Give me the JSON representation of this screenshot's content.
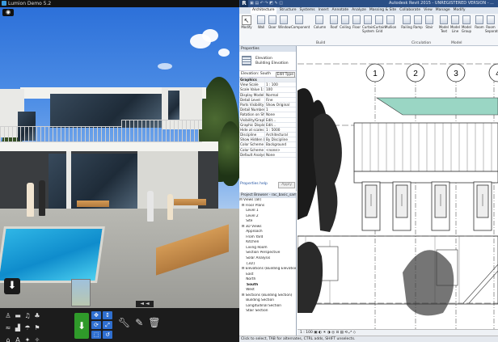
{
  "lumion": {
    "title": "Lumion Demo 5.2",
    "eye_icon": "eye-icon",
    "download_icon": "download-icon",
    "toolbar": {
      "left_icons": [
        "person-icon",
        "car-icon",
        "sound-icon",
        "tree-icon",
        "fish-icon",
        "building-icon",
        "person-walk-icon",
        "flag-icon",
        "home-icon",
        "text-icon",
        "effect-icon",
        "spark-icon"
      ],
      "mode_icon": "download-icon",
      "move_icons": [
        "move-icon",
        "height-icon",
        "rotate-icon",
        "scale-icon",
        "select-icon",
        "delete-icon"
      ],
      "tools": [
        "wrench-icon",
        "pencil-icon",
        "trash-icon"
      ],
      "progress_label": "◄ ◄"
    }
  },
  "revit": {
    "title": "Autodesk Revit 2015 - UNREGISTERED VERSION - ...",
    "qat": "▣ ▤ ↶ ↷ ◩ ✎ ◫",
    "tabs": [
      "Architecture",
      "Structure",
      "Systems",
      "Insert",
      "Annotate",
      "Analyze",
      "Massing & Site",
      "Collaborate",
      "View",
      "Manage",
      "Modify"
    ],
    "active_tab": "Architecture",
    "modify": {
      "label": "Modify"
    },
    "select_label": "Select ▾",
    "ribbon_buttons": [
      "Wall",
      "Door",
      "Window",
      "Component",
      "Column",
      "Roof",
      "Ceiling",
      "Floor",
      "Curtain System",
      "Curtain Grid",
      "Mullion",
      "Railing",
      "Ramp",
      "Stair",
      "Model Text",
      "Model Line",
      "Model Group",
      "Room",
      "Room Separator"
    ],
    "groups": [
      "Build",
      "Circulation",
      "Model"
    ],
    "properties": {
      "header": "Properties",
      "type_family": "Elevation",
      "type_name": "Building Elevation",
      "filter": "Elevation: South",
      "edit_type": "Edit Type",
      "rows": [
        {
          "k": "Graphics",
          "v": "",
          "sec": true
        },
        {
          "k": "View Scale",
          "v": "1 : 100"
        },
        {
          "k": "Scale Value  1:",
          "v": "100"
        },
        {
          "k": "Display Model",
          "v": "Normal"
        },
        {
          "k": "Detail Level",
          "v": "Fine"
        },
        {
          "k": "Parts Visibility",
          "v": "Show Original"
        },
        {
          "k": "Detail Number",
          "v": "1"
        },
        {
          "k": "Rotation on Sh...",
          "v": "None"
        },
        {
          "k": "Visibility/Graph...",
          "v": "Edit..."
        },
        {
          "k": "Graphic Display...",
          "v": "Edit..."
        },
        {
          "k": "Hide at scales c...",
          "v": "1 : 5000"
        },
        {
          "k": "Discipline",
          "v": "Architectural"
        },
        {
          "k": "Show Hidden L...",
          "v": "By Discipline"
        },
        {
          "k": "Color Scheme ...",
          "v": "Background"
        },
        {
          "k": "Color Scheme",
          "v": "<none>"
        },
        {
          "k": "Default Analysi...",
          "v": "None"
        }
      ],
      "help_link": "Properties help",
      "apply": "Apply"
    },
    "browser": {
      "header": "Project Browser - rac_basic_sample_...",
      "items": [
        "⊟ Views (all)",
        "  ⊟ Floor Plans",
        "      Level 1",
        "      Level 2",
        "      Site",
        "  ⊟ 3D Views",
        "      Approach",
        "      From Yard",
        "      Kitchen",
        "      Living Room",
        "      Section Perspective",
        "      Solar Analysis",
        "      {3D}",
        "  ⊟ Elevations (Building Elevation",
        "      East",
        "      North",
        "      South",
        "      West",
        "  ⊟ Sections (Building Section)",
        "      Building Section",
        "      Longitudinal Section",
        "      Stair Section"
      ],
      "selected_index": 16
    },
    "canvas": {
      "grid_labels": [
        "1",
        "2",
        "3",
        "4"
      ]
    },
    "viewbar": "1 : 100   ▣ ◐ ☀ ◑ ◎ ⊡ ▤ ⟲ ⤢ ◇",
    "status": "Click to select, TAB for alternates, CTRL adds, SHIFT unselects."
  }
}
